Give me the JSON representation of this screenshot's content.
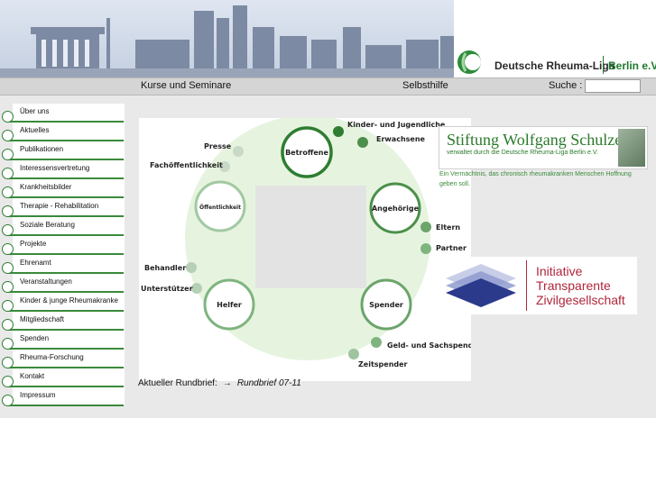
{
  "header": {
    "logo_text": "Deutsche Rheuma-Liga",
    "logo_city": "Berlin e.V."
  },
  "nav": {
    "items": [
      "Kurse und Seminare",
      "Selbsthilfe"
    ],
    "search_label": "Suche :",
    "search_value": ""
  },
  "sidebar": {
    "items": [
      "Über uns",
      "Aktuelles",
      "Publikationen",
      "Interessensvertretung",
      "Krankheitsbilder",
      "Therapie - Rehabilitation",
      "Soziale Beratung",
      "Projekte",
      "Ehrenamt",
      "Veranstaltungen",
      "Kinder & junge Rheumakranke",
      "Mitgliedschaft",
      "Spenden",
      "Rheuma-Forschung",
      "Kontakt",
      "Impressum"
    ]
  },
  "diagram": {
    "hubs": {
      "betroffene": "Betroffene",
      "angehoerige": "Angehörige",
      "spender": "Spender",
      "helfer": "Helfer",
      "oeffentlichkeit": "Öffentlichkeit"
    },
    "satellites": {
      "kinder": "Kinder- und Jugendliche",
      "erwachsene": "Erwachsene",
      "presse": "Presse",
      "fachoeff": "Fachöffentlichkeit",
      "eltern": "Eltern",
      "partner": "Partner",
      "behandler": "Behandler",
      "unterstuetzer": "Unterstützer",
      "geld": "Geld- und Sachspender",
      "zeit": "Zeitspender"
    }
  },
  "rundbrief": {
    "label": "Aktueller Rundbrief:",
    "arrow": "→",
    "link": "Rundbrief 07-11"
  },
  "stiftung": {
    "title": "Stiftung Wolfgang Schulze",
    "subtitle": "verwaltet durch die Deutsche Rheuma-Liga Berlin e.V.",
    "tagline": "Ein Vermächtnis, das chronisch rheumakranken Menschen Hoffnung geben soll."
  },
  "itz": {
    "line1": "Initiative",
    "line2": "Transparente",
    "line3": "Zivilgesellschaft"
  }
}
